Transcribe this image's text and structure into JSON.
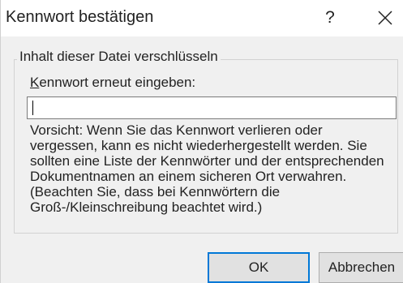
{
  "window": {
    "title": "Kennwort bestätigen",
    "help_label": "?"
  },
  "group": {
    "legend": "Inhalt dieser Datei verschlüsseln"
  },
  "password_field": {
    "label_accel": "K",
    "label_rest": "ennwort erneut eingeben:",
    "value": ""
  },
  "warning_lines": [
    "Vorsicht: Wenn Sie das Kennwort verlieren oder",
    "vergessen, kann es nicht wiederhergestellt werden. Sie",
    "sollten eine Liste der Kennwörter und der entsprechenden",
    "Dokumentnamen an einem sicheren Ort verwahren.",
    "(Beachten Sie, dass bei Kennwörtern die",
    "Groß-/Kleinschreibung beachtet wird.)"
  ],
  "buttons": {
    "ok": "OK",
    "cancel": "Abbrechen"
  },
  "icons": {
    "close": "close-icon"
  },
  "colors": {
    "focus_border": "#0078d7",
    "dialog_bg": "#f0f0f0"
  }
}
